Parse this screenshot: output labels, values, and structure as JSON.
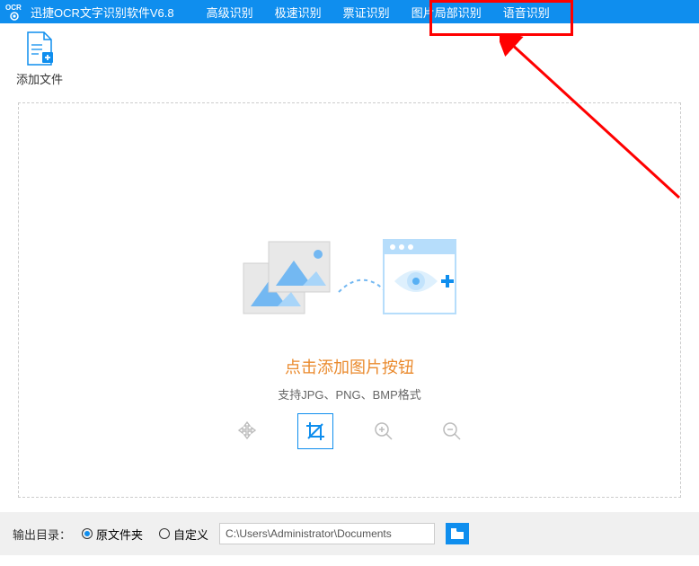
{
  "header": {
    "logo_top": "OCR",
    "app_title": "迅捷OCR文字识别软件V6.8",
    "tabs": [
      "高级识别",
      "极速识别",
      "票证识别",
      "图片局部识别",
      "语音识别"
    ]
  },
  "toolbar": {
    "add_file": "添加文件"
  },
  "dropzone": {
    "prompt": "点击添加图片按钮",
    "subtext": "支持JPG、PNG、BMP格式"
  },
  "footer": {
    "label": "输出目录：",
    "radio_original": "原文件夹",
    "radio_custom": "自定义",
    "path": "C:\\Users\\Administrator\\Documents"
  },
  "colors": {
    "primary": "#0f8eee",
    "accent": "#ea8a2d"
  }
}
